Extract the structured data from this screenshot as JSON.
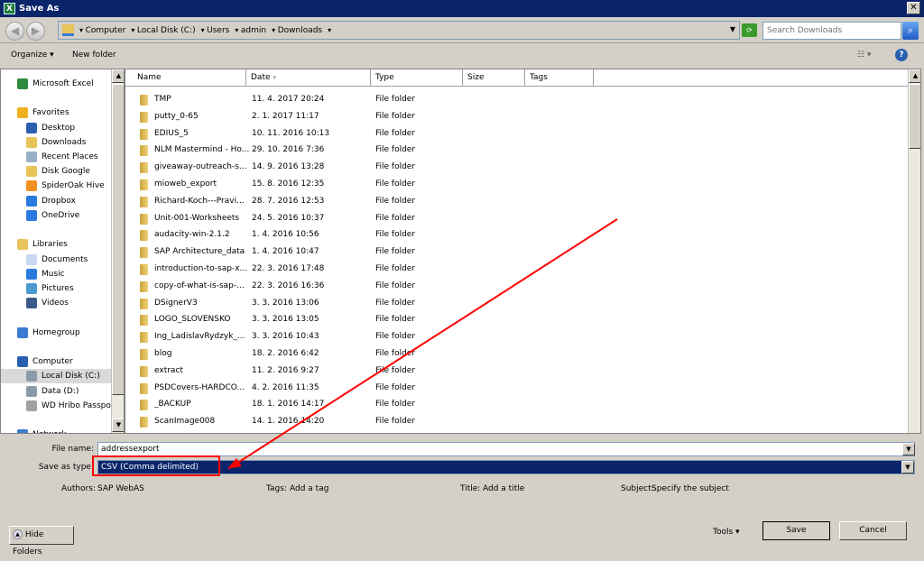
{
  "window": {
    "title": "Save As",
    "close": "✕"
  },
  "nav": {
    "back": "◀",
    "forward": "▶",
    "breadcrumb": [
      "Computer",
      "Local Disk (C:)",
      "Users",
      "admin",
      "Downloads"
    ],
    "search_placeholder": "Search Downloads"
  },
  "toolbar": {
    "organize": "Organize ▾",
    "new_folder": "New folder",
    "view": "☷ ▾",
    "help": "?"
  },
  "sidebar": {
    "items": [
      {
        "label": "Microsoft Excel",
        "icon": "excel-icon",
        "color": "#2e8b3e",
        "kind": "top"
      },
      {
        "label": "Favorites",
        "icon": "star-icon",
        "color": "#f0b020",
        "kind": "top"
      },
      {
        "label": "Desktop",
        "icon": "desktop-icon",
        "color": "#2a5fb0",
        "kind": "sub"
      },
      {
        "label": "Downloads",
        "icon": "downloads-folder-icon",
        "color": "#e8c35a",
        "kind": "sub"
      },
      {
        "label": "Recent Places",
        "icon": "recent-places-icon",
        "color": "#9ab0c8",
        "kind": "sub"
      },
      {
        "label": "Disk Google",
        "icon": "google-drive-icon",
        "color": "#e8c35a",
        "kind": "sub"
      },
      {
        "label": "SpiderOak Hive",
        "icon": "spideroak-icon",
        "color": "#f09020",
        "kind": "sub"
      },
      {
        "label": "Dropbox",
        "icon": "dropbox-icon",
        "color": "#2a7ae0",
        "kind": "sub"
      },
      {
        "label": "OneDrive",
        "icon": "onedrive-icon",
        "color": "#2a7ae0",
        "kind": "sub"
      },
      {
        "label": "Libraries",
        "icon": "libraries-icon",
        "color": "#e8c35a",
        "kind": "top"
      },
      {
        "label": "Documents",
        "icon": "documents-icon",
        "color": "#c8d8f0",
        "kind": "sub"
      },
      {
        "label": "Music",
        "icon": "music-icon",
        "color": "#2a7ae0",
        "kind": "sub"
      },
      {
        "label": "Pictures",
        "icon": "pictures-icon",
        "color": "#4a9ad0",
        "kind": "sub"
      },
      {
        "label": "Videos",
        "icon": "videos-icon",
        "color": "#3a5a8a",
        "kind": "sub"
      },
      {
        "label": "Homegroup",
        "icon": "homegroup-icon",
        "color": "#3a7ad0",
        "kind": "top"
      },
      {
        "label": "Computer",
        "icon": "computer-icon",
        "color": "#2a5fb0",
        "kind": "top"
      },
      {
        "label": "Local Disk (C:)",
        "icon": "drive-icon",
        "color": "#8a9aa8",
        "kind": "sub",
        "selected": true
      },
      {
        "label": "Data (D:)",
        "icon": "drive-icon",
        "color": "#8a9aa8",
        "kind": "sub"
      },
      {
        "label": "WD Hribo Passport",
        "icon": "external-drive-icon",
        "color": "#a0a0a0",
        "kind": "sub"
      },
      {
        "label": "Network",
        "icon": "network-icon",
        "color": "#3a7ad0",
        "kind": "top"
      }
    ]
  },
  "columns": [
    "Name",
    "Date",
    "Type",
    "Size",
    "Tags"
  ],
  "files": [
    {
      "name": "TMP",
      "date": "11. 4. 2017 20:24",
      "type": "File folder"
    },
    {
      "name": "putty_0-65",
      "date": "2. 1. 2017 11:17",
      "type": "File folder"
    },
    {
      "name": "EDIUS_5",
      "date": "10. 11. 2016 10:13",
      "type": "File folder"
    },
    {
      "name": "NLM Mastermind - Ho...",
      "date": "29. 10. 2016 7:36",
      "type": "File folder"
    },
    {
      "name": "giveaway-outreach-s...",
      "date": "14. 9. 2016 13:28",
      "type": "File folder"
    },
    {
      "name": "mioweb_export",
      "date": "15. 8. 2016 12:35",
      "type": "File folder"
    },
    {
      "name": "Richard-Koch---Pravi...",
      "date": "28. 7. 2016 12:53",
      "type": "File folder"
    },
    {
      "name": "Unit-001-Worksheets",
      "date": "24. 5. 2016 10:37",
      "type": "File folder"
    },
    {
      "name": "audacity-win-2.1.2",
      "date": "1. 4. 2016 10:56",
      "type": "File folder"
    },
    {
      "name": "SAP Architecture_data",
      "date": "1. 4. 2016 10:47",
      "type": "File folder"
    },
    {
      "name": "introduction-to-sap-x...",
      "date": "22. 3. 2016 17:48",
      "type": "File folder"
    },
    {
      "name": "copy-of-what-is-sap-...",
      "date": "22. 3. 2016 16:36",
      "type": "File folder"
    },
    {
      "name": "DSignerV3",
      "date": "3. 3. 2016 13:06",
      "type": "File folder"
    },
    {
      "name": "LOGO_SLOVENSKO",
      "date": "3. 3. 2016 13:05",
      "type": "File folder"
    },
    {
      "name": "Ing_LadislavRydzyk_...",
      "date": "3. 3. 2016 10:43",
      "type": "File folder"
    },
    {
      "name": "blog",
      "date": "18. 2. 2016 6:42",
      "type": "File folder"
    },
    {
      "name": "extract",
      "date": "11. 2. 2016 9:27",
      "type": "File folder"
    },
    {
      "name": "PSDCovers-HARDCO...",
      "date": "4. 2. 2016 11:35",
      "type": "File folder"
    },
    {
      "name": "_BACKUP",
      "date": "18. 1. 2016 14:17",
      "type": "File folder"
    },
    {
      "name": "ScanImage008",
      "date": "14. 1. 2016 14:20",
      "type": "File folder"
    }
  ],
  "form": {
    "file_name_label": "File name:",
    "file_name": "addressexport",
    "save_type_label": "Save as type:",
    "save_type": "CSV (Comma delimited)"
  },
  "meta": {
    "authors_label": "Authors:",
    "authors": "SAP WebAS",
    "tags_label": "Tags:",
    "tags": "Add a tag",
    "title_label": "Title:",
    "title": "Add a title",
    "subject_label": "Subject:",
    "subject": "Specify the subject"
  },
  "buttons": {
    "hide_folders": "Hide Folders",
    "tools": "Tools ▾",
    "save": "Save",
    "cancel": "Cancel"
  },
  "colors": {
    "titlebar": "#0a246a",
    "annotation": "#ff0000",
    "selection": "#0a246a"
  }
}
